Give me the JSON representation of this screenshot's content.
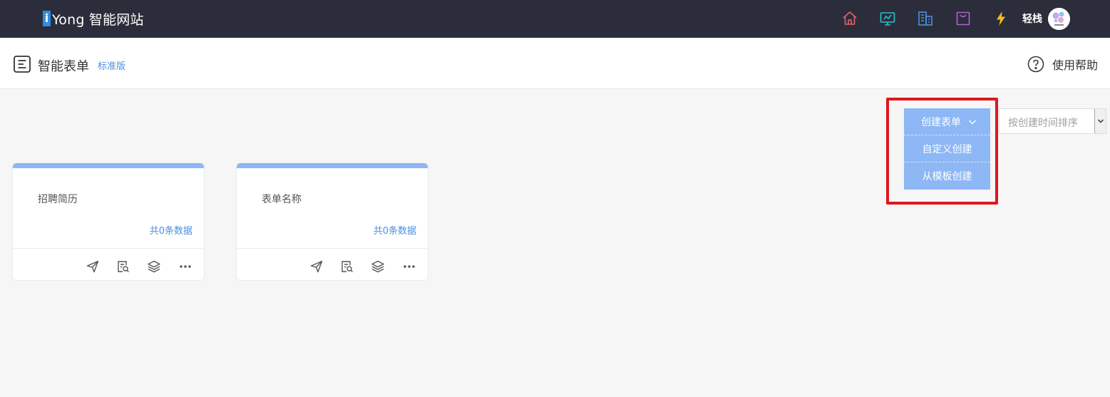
{
  "brand": {
    "logo_letter": "i",
    "name": "Yong 智能网站"
  },
  "topbar": {
    "icons": [
      "home-icon",
      "monitor-icon",
      "building-icon",
      "bag-icon",
      "lightning-icon"
    ],
    "colors": {
      "home": "#e4606d",
      "monitor": "#28c0c9",
      "building": "#4a90e2",
      "bag": "#b35fd6",
      "lightning": "#f5b91c"
    },
    "username": "轻栈"
  },
  "header": {
    "title": "智能表单",
    "edition": "标准版",
    "help_label": "使用帮助"
  },
  "create_menu": {
    "label": "创建表单",
    "items": [
      "自定义创建",
      "从模板创建"
    ]
  },
  "sort": {
    "selected": "按创建时间排序"
  },
  "cards": [
    {
      "title": "招聘简历",
      "count_text": "共0条数据"
    },
    {
      "title": "表单名称",
      "count_text": "共0条数据"
    }
  ],
  "card_actions": [
    "send-icon",
    "preview-icon",
    "layers-icon",
    "more-icon"
  ],
  "accent_color": "#8db7f5"
}
